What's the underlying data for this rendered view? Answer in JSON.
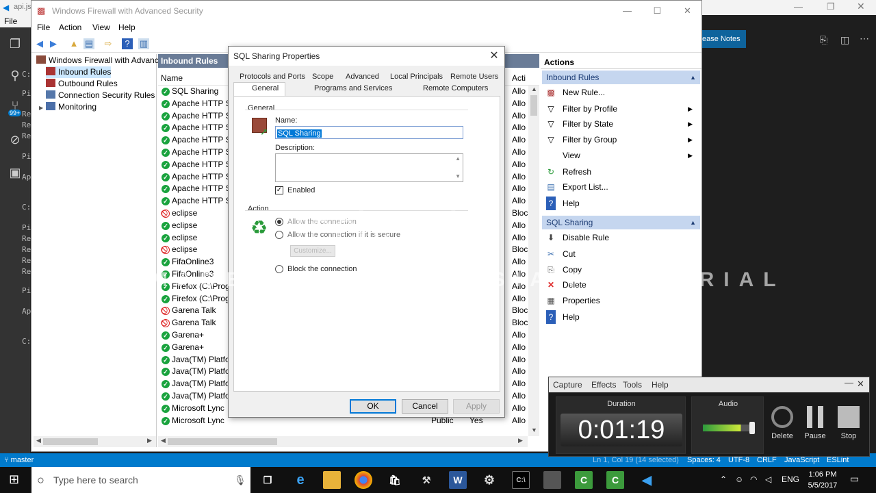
{
  "vscode": {
    "title_partial": "api.js",
    "menu_file": "File",
    "left_letters": [
      "C:",
      "Pi",
      "Re",
      "Re",
      "Re",
      "Pi",
      "Ap",
      "C:",
      "Pi",
      "Re",
      "Re",
      "Re",
      "Re",
      "Pi",
      "Ap",
      "C:"
    ],
    "release_notes": "ease Notes",
    "status": {
      "branch": "master",
      "position": "Ln 1, Col 19 (14 selected)",
      "spaces": "Spaces: 4",
      "encoding": "UTF-8",
      "eol": "CRLF",
      "language": "JavaScript",
      "linter": "ESLint"
    },
    "badge": "99+"
  },
  "firewall": {
    "title": "Windows Firewall with Advanced Security",
    "menu": [
      "File",
      "Action",
      "View",
      "Help"
    ],
    "tree": {
      "root": "Windows Firewall with Advance",
      "items": [
        "Inbound Rules",
        "Outbound Rules",
        "Connection Security Rules",
        "Monitoring"
      ]
    },
    "rules_header": "Inbound Rules",
    "columns": {
      "name": "Name",
      "profile": "",
      "enabled": "",
      "action": "Acti"
    },
    "rules": [
      {
        "name": "SQL Sharing",
        "status": "allow",
        "profile": "",
        "enabled": "",
        "action": "Allo"
      },
      {
        "name": "Apache HTTP Se",
        "status": "allow",
        "profile": "",
        "enabled": "",
        "action": "Allo"
      },
      {
        "name": "Apache HTTP Se",
        "status": "allow",
        "profile": "",
        "enabled": "",
        "action": "Allo"
      },
      {
        "name": "Apache HTTP Se",
        "status": "allow",
        "profile": "",
        "enabled": "",
        "action": "Allo"
      },
      {
        "name": "Apache HTTP Se",
        "status": "allow",
        "profile": "",
        "enabled": "",
        "action": "Allo"
      },
      {
        "name": "Apache HTTP Se",
        "status": "allow",
        "profile": "",
        "enabled": "",
        "action": "Allo"
      },
      {
        "name": "Apache HTTP Se",
        "status": "allow",
        "profile": "",
        "enabled": "",
        "action": "Allo"
      },
      {
        "name": "Apache HTTP Se",
        "status": "allow",
        "profile": "",
        "enabled": "",
        "action": "Allo"
      },
      {
        "name": "Apache HTTP Se",
        "status": "allow",
        "profile": "",
        "enabled": "",
        "action": "Allo"
      },
      {
        "name": "Apache HTTP Se",
        "status": "allow",
        "profile": "",
        "enabled": "",
        "action": "Allo"
      },
      {
        "name": "eclipse",
        "status": "block",
        "profile": "",
        "enabled": "",
        "action": "Bloc"
      },
      {
        "name": "eclipse",
        "status": "allow",
        "profile": "",
        "enabled": "",
        "action": "Allo"
      },
      {
        "name": "eclipse",
        "status": "allow",
        "profile": "",
        "enabled": "",
        "action": "Allo"
      },
      {
        "name": "eclipse",
        "status": "block",
        "profile": "",
        "enabled": "",
        "action": "Bloc"
      },
      {
        "name": "FifaOnline3",
        "status": "allow",
        "profile": "",
        "enabled": "",
        "action": "Allo"
      },
      {
        "name": "FifaOnline3",
        "status": "allow",
        "profile": "",
        "enabled": "",
        "action": "Allo"
      },
      {
        "name": "Firefox (C:\\Progr",
        "status": "allow",
        "profile": "",
        "enabled": "",
        "action": "Allo"
      },
      {
        "name": "Firefox (C:\\Progr",
        "status": "allow",
        "profile": "",
        "enabled": "",
        "action": "Allo"
      },
      {
        "name": "Garena Talk",
        "status": "block",
        "profile": "",
        "enabled": "",
        "action": "Bloc"
      },
      {
        "name": "Garena Talk",
        "status": "block",
        "profile": "",
        "enabled": "",
        "action": "Bloc"
      },
      {
        "name": "Garena+",
        "status": "allow",
        "profile": "",
        "enabled": "",
        "action": "Allo"
      },
      {
        "name": "Garena+",
        "status": "allow",
        "profile": "",
        "enabled": "",
        "action": "Allo"
      },
      {
        "name": "Java(TM) Platfor",
        "status": "allow",
        "profile": "",
        "enabled": "",
        "action": "Allo"
      },
      {
        "name": "Java(TM) Platfor",
        "status": "allow",
        "profile": "",
        "enabled": "",
        "action": "Allo"
      },
      {
        "name": "Java(TM) Platfor",
        "status": "allow",
        "profile": "",
        "enabled": "",
        "action": "Allo"
      },
      {
        "name": "Java(TM) Platfor",
        "status": "allow",
        "profile": "",
        "enabled": "",
        "action": "Allo"
      },
      {
        "name": "Microsoft Lync",
        "status": "allow",
        "profile": "Public",
        "enabled": "Yes",
        "action": "Allo"
      },
      {
        "name": "Microsoft Lync",
        "status": "allow",
        "profile": "Public",
        "enabled": "Yes",
        "action": "Allo"
      }
    ],
    "actions": {
      "header": "Actions",
      "section1": "Inbound Rules",
      "items1": [
        {
          "label": "New Rule...",
          "icon": "new-rule-icon",
          "arrow": false
        },
        {
          "label": "Filter by Profile",
          "icon": "filter-icon",
          "arrow": true
        },
        {
          "label": "Filter by State",
          "icon": "filter-icon",
          "arrow": true
        },
        {
          "label": "Filter by Group",
          "icon": "filter-icon",
          "arrow": true
        },
        {
          "label": "View",
          "icon": "",
          "arrow": true
        },
        {
          "label": "Refresh",
          "icon": "refresh-icon",
          "arrow": false
        },
        {
          "label": "Export List...",
          "icon": "export-icon",
          "arrow": false
        },
        {
          "label": "Help",
          "icon": "help-icon",
          "arrow": false
        }
      ],
      "section2": "SQL Sharing",
      "items2": [
        {
          "label": "Disable Rule",
          "icon": "disable-icon",
          "arrow": false
        },
        {
          "label": "Cut",
          "icon": "cut-icon",
          "arrow": false
        },
        {
          "label": "Copy",
          "icon": "copy-icon",
          "arrow": false
        },
        {
          "label": "Delete",
          "icon": "delete-icon",
          "arrow": false
        },
        {
          "label": "Properties",
          "icon": "properties-icon",
          "arrow": false
        },
        {
          "label": "Help",
          "icon": "help-icon",
          "arrow": false
        }
      ]
    }
  },
  "dialog": {
    "title": "SQL Sharing Properties",
    "tabs_row1": [
      "Protocols and Ports",
      "Scope",
      "Advanced",
      "Local Principals",
      "Remote Users"
    ],
    "tabs_row2": [
      "General",
      "Programs and Services",
      "Remote Computers"
    ],
    "general_group": "General",
    "name_label": "Name:",
    "name_value": "SQL Sharing",
    "description_label": "Description:",
    "description_value": "",
    "enabled_label": "Enabled",
    "action_group": "Action",
    "allow_label": "Allow the connection",
    "allow_secure_label": "Allow the connection if it is secure",
    "customize_label": "Customize...",
    "block_label": "Block the connection",
    "ok": "OK",
    "cancel": "Cancel",
    "apply": "Apply"
  },
  "watermark": {
    "logo": "TechSmith",
    "trial": "MADE WITH CAMTASIA FREE TRIAL"
  },
  "recorder": {
    "menu": [
      "Capture",
      "Effects",
      "Tools",
      "Help"
    ],
    "duration_label": "Duration",
    "duration": "0:01:19",
    "audio_label": "Audio",
    "delete": "Delete",
    "pause": "Pause",
    "stop": "Stop"
  },
  "taskbar": {
    "search_placeholder": "Type here to search",
    "language": "ENG",
    "time": "1:06 PM",
    "date": "5/5/2017"
  }
}
